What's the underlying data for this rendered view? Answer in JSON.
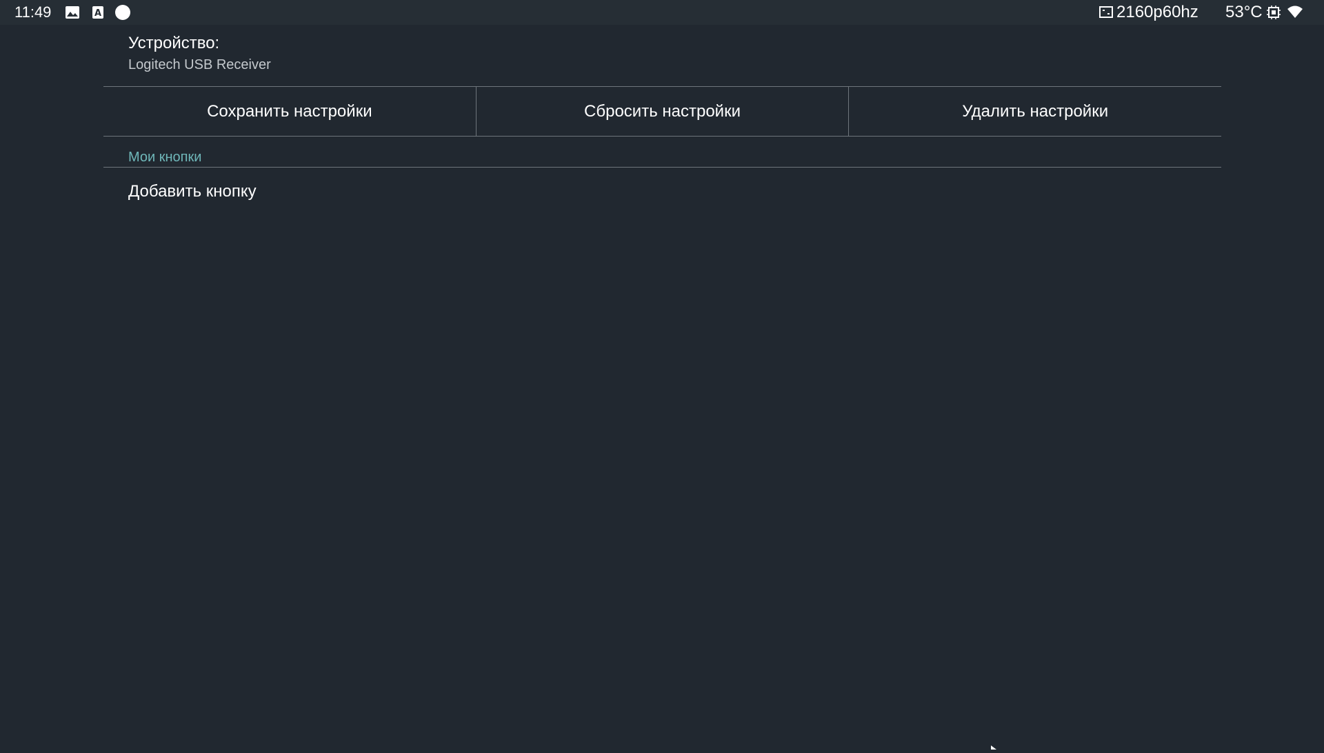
{
  "status_bar": {
    "time": "11:49",
    "left_icons": [
      "image-icon",
      "a-notification-icon",
      "circle-notification-icon"
    ],
    "resolution": "2160p60hz",
    "temperature": "53°C",
    "right_icons": [
      "display-icon",
      "cpu-chip-icon",
      "wifi-icon"
    ]
  },
  "device": {
    "label": "Устройство:",
    "name": "Logitech USB Receiver"
  },
  "actions": {
    "save_label": "Сохранить настройки",
    "reset_label": "Сбросить настройки",
    "delete_label": "Удалить настройки"
  },
  "my_buttons": {
    "header": "Мои кнопки",
    "add_label": "Добавить кнопку"
  },
  "colors": {
    "background": "#212830",
    "status_bar": "#262e35",
    "accent": "#6fb7b9",
    "divider": "#6f767c",
    "secondary_text": "#c4c9cd"
  }
}
